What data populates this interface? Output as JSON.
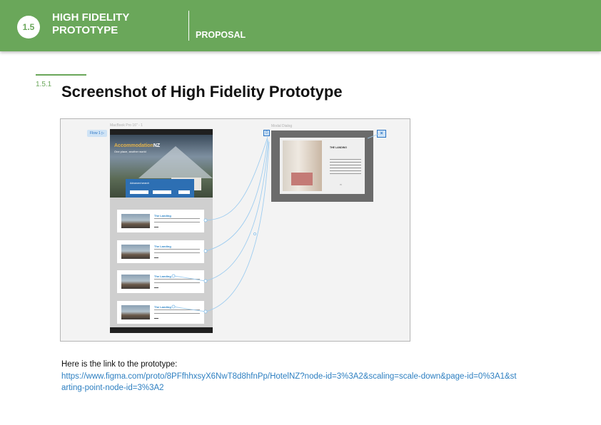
{
  "header": {
    "section_number": "1.5",
    "title": "HIGH FIDELITY PROTOTYPE",
    "category": "PROPOSAL"
  },
  "section": {
    "number": "1.5.1",
    "title": "Screenshot of High Fidelity Prototype"
  },
  "prototype": {
    "frame_label": "MacBook Pro 16\" - 1",
    "modal_label": "Modal Dialog",
    "flow_label": "Flow 1",
    "hero_title_main": "Accommodation",
    "hero_title_accent": "NZ",
    "hero_subtitle": "One place, another world",
    "search_title": "Advanced search",
    "card_titles": [
      "The Landing",
      "The Landing",
      "The Landing",
      "The Landing"
    ],
    "modal_title": "THE LANDING",
    "close_symbol": "×"
  },
  "link": {
    "intro": "Here is the link to the prototype:",
    "url": "https://www.figma.com/proto/8PFfhhxsyX6NwT8d8hfnPp/HotelNZ?node-id=3%3A2&scaling=scale-down&page-id=0%3A1&starting-point-node-id=3%3A2"
  }
}
